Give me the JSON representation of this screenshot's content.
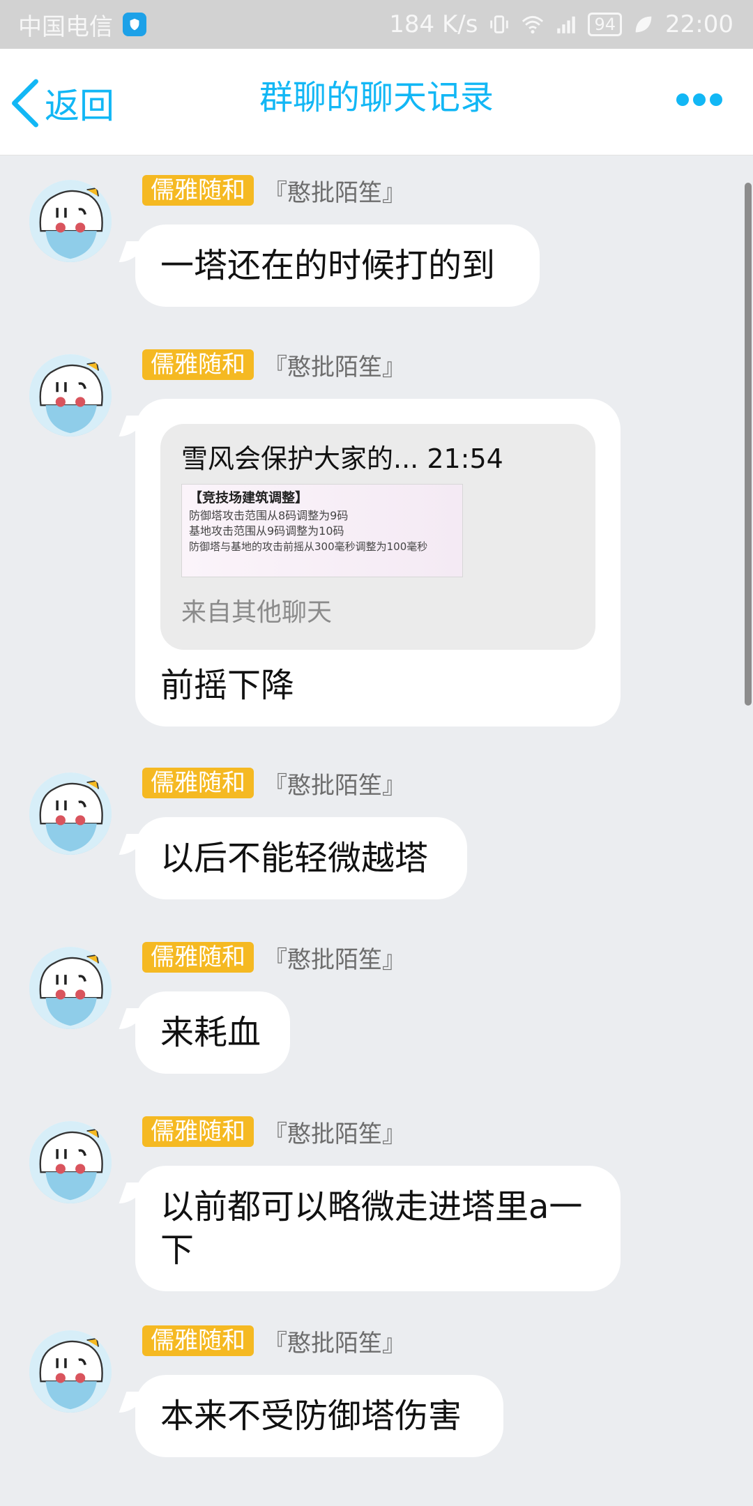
{
  "status_bar": {
    "carrier": "中国电信",
    "net_speed": "184 K/s",
    "signal_type": "4G",
    "battery": "94",
    "time": "22:00"
  },
  "nav": {
    "back_label": "返回",
    "title": "群聊的聊天记录"
  },
  "messages": [
    {
      "badge": "儒雅随和",
      "nickname": "『憨批陌笙』",
      "text": "一塔还在的时候打的到"
    },
    {
      "badge": "儒雅随和",
      "nickname": "『憨批陌笙』",
      "quote": {
        "header": "雪风会保护大家的... 21:54",
        "image_title": "【竞技场建筑调整】",
        "image_lines": [
          "防御塔攻击范围从8码调整为9码",
          "基地攻击范围从9码调整为10码",
          "防御塔与基地的攻击前摇从300毫秒调整为100毫秒"
        ],
        "source": "来自其他聊天"
      },
      "text": "前摇下降"
    },
    {
      "badge": "儒雅随和",
      "nickname": "『憨批陌笙』",
      "text": "以后不能轻微越塔"
    },
    {
      "badge": "儒雅随和",
      "nickname": "『憨批陌笙』",
      "text": "来耗血"
    },
    {
      "badge": "儒雅随和",
      "nickname": "『憨批陌笙』",
      "text": "以前都可以略微走进塔里a一下"
    },
    {
      "badge": "儒雅随和",
      "nickname": "『憨批陌笙』",
      "text": "本来不受防御塔伤害"
    }
  ],
  "colors": {
    "accent": "#12b7f5",
    "badge": "#f5b922",
    "background": "#ebedf0"
  }
}
